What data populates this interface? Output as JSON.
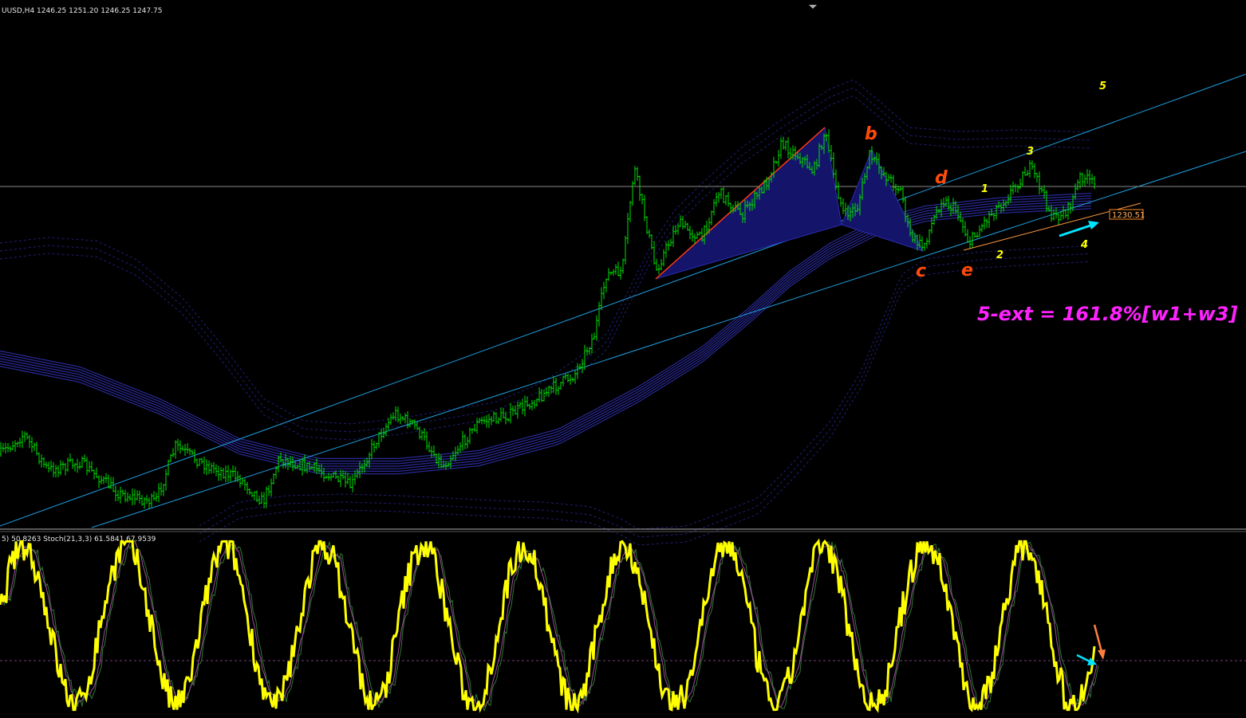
{
  "header": {
    "symbol_line": "UUSD,H4  1246.25 1251.20 1246.25 1247.75",
    "indicator_line": "5) 50.8263  Stoch(21,3,3) 61.5841 67.9539"
  },
  "colors": {
    "background": "#000000",
    "candles": "#00e000",
    "envelope_solid": "#2a2a9a",
    "envelope_dashed": "#1f1f78",
    "channel": "#1e9fe0",
    "pattern_fill": "#14146a",
    "stoch_main": "#ffff00",
    "stoch_signal": "#9a4d9a",
    "label_orange": "#ff4a0a",
    "label_yellow": "#ffff00",
    "annotation_magenta": "#ff22ff",
    "arrow_cyan": "#00e5ff",
    "arrow_orange": "#ff7f3f"
  },
  "chart_data": {
    "type": "candlestick",
    "symbol_timeframe": "UUSD,H4",
    "ohlc_current": {
      "open": 1246.25,
      "high": 1251.2,
      "low": 1246.25,
      "close": 1247.75
    },
    "price_tag": "1230.51",
    "wave_labels_orange": [
      "b",
      "c",
      "d",
      "e"
    ],
    "wave_labels_yellow": [
      "1",
      "2",
      "3",
      "4",
      "5"
    ],
    "annotation": "5-ext = 161.8%[w1+w3]",
    "stochastic": {
      "name": "Stoch(21,3,3)",
      "main": 61.5841,
      "signal": 67.9539,
      "prefix_value": 50.8263
    }
  }
}
